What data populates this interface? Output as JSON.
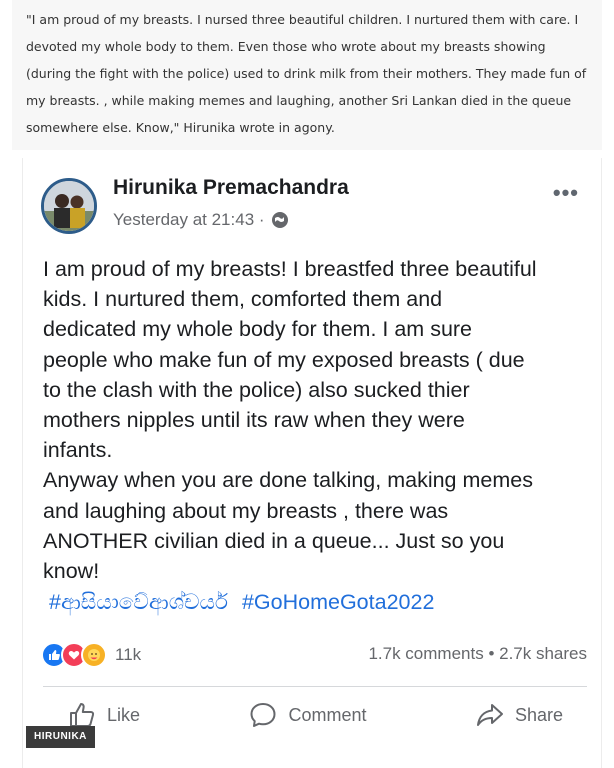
{
  "article": {
    "quote": "\"I am proud of my breasts. I nursed three beautiful children. I nurtured them with care. I devoted my whole body to them. Even those who wrote about my breasts showing (during the fight with the police) used to drink milk from their mothers. They made fun of my breasts. , while making memes and laughing, another Sri Lankan died in the queue somewhere else. Know,\" Hirunika wrote in agony."
  },
  "post": {
    "author": "Hirunika Premachandra",
    "timestamp": "Yesterday at 21:43 ·",
    "privacy_icon": "globe-icon",
    "more_icon": "more-dots-icon",
    "body": [
      "I am proud of my breasts! I breastfed three beautiful",
      "kids. I nurtured them, comforted them and",
      "dedicated my whole body for them. I am sure",
      "people who make fun of my exposed breasts ( due",
      "to the clash with the police) also sucked thier",
      "mothers nipples until its raw when they were",
      "infants.",
      "Anyway when you are done talking, making memes",
      "and laughing about my breasts , there was",
      "ANOTHER civilian died in a queue... Just so you",
      "know!"
    ],
    "hashtags": [
      "#ආසියාවේආශ්චර්ය",
      "#GoHomeGota2022"
    ],
    "reactions": {
      "icons": [
        "like-icon",
        "love-icon",
        "care-icon"
      ],
      "count": "11k"
    },
    "counts": "1.7k comments • 2.7k shares",
    "actions": {
      "like": "Like",
      "comment": "Comment",
      "share": "Share"
    }
  },
  "watermark": "HIRUNIKA",
  "colors": {
    "link": "#216fdb",
    "like": "#1877f2",
    "love": "#f33e58",
    "care": "#f7b125"
  }
}
